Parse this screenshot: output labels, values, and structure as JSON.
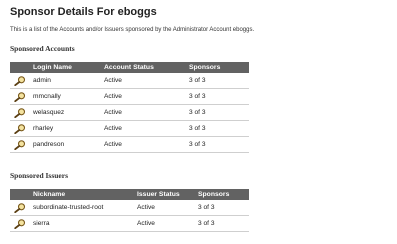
{
  "header": {
    "title": "Sponsor Details For eboggs",
    "description": "This is a list of the Accounts and/or Issuers sponsored by the Administrator Account eboggs."
  },
  "accounts": {
    "section_title": "Sponsored Accounts",
    "columns": [
      "",
      "Login Name",
      "Account Status",
      "Sponsors"
    ],
    "rows": [
      {
        "login": "admin",
        "status": "Active",
        "sponsors": "3 of 3"
      },
      {
        "login": "mmcnally",
        "status": "Active",
        "sponsors": "3 of 3"
      },
      {
        "login": "welasquez",
        "status": "Active",
        "sponsors": "3 of 3"
      },
      {
        "login": "rharley",
        "status": "Active",
        "sponsors": "3 of 3"
      },
      {
        "login": "pandreson",
        "status": "Active",
        "sponsors": "3 of 3"
      }
    ]
  },
  "issuers": {
    "section_title": "Sponsored Issuers",
    "columns": [
      "",
      "Nickname",
      "Issuer Status",
      "Sponsors"
    ],
    "rows": [
      {
        "nickname": "subordinate-trusted-root",
        "status": "Active",
        "sponsors": "3 of 3"
      },
      {
        "nickname": "sierra",
        "status": "Active",
        "sponsors": "3 of 3"
      }
    ]
  },
  "icons": {
    "row_action": "magnifier-icon"
  },
  "colors": {
    "header_bg": "#626262",
    "header_text": "#ffffff",
    "row_border": "#cfcfcf"
  }
}
